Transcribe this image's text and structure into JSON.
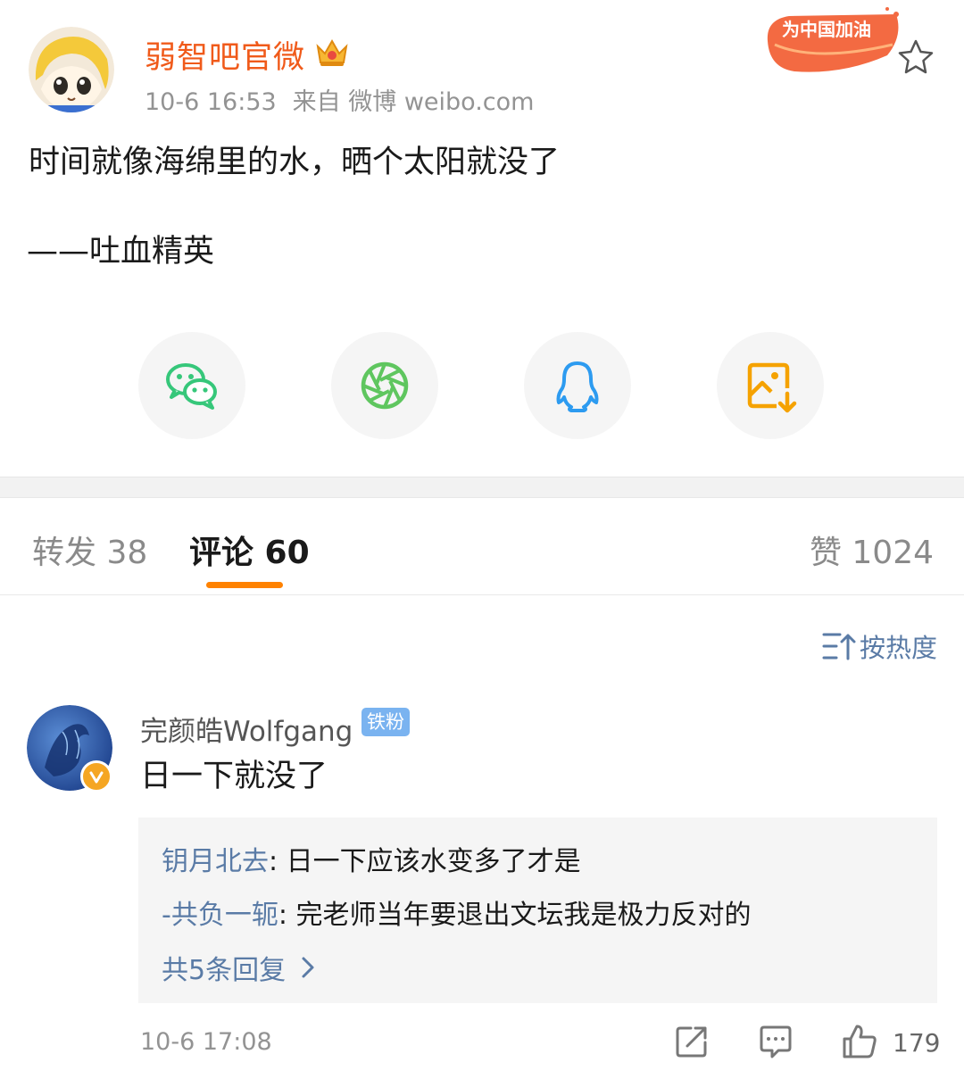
{
  "post": {
    "author": "弱智吧官微",
    "time": "10-6 16:53",
    "source": "来自 微博 weibo.com",
    "banner_text": "为中国加油",
    "text": "时间就像海绵里的水，晒个太阳就没了",
    "signature": "——吐血精英"
  },
  "share": {
    "items": [
      "wechat-icon",
      "moments-icon",
      "qq-icon",
      "save-image-icon"
    ],
    "colors": {
      "wechat": "#36c77a",
      "moments": "#5fc65f",
      "qq": "#2d9bf0",
      "save": "#f5a200"
    }
  },
  "tabs": {
    "repost": "转发 38",
    "comments": "评论 60",
    "likes": "赞 1024"
  },
  "sort": {
    "label": "按热度"
  },
  "comment": {
    "user": "完颜皓Wolfgang",
    "badge": "铁粉",
    "text": "日一下就没了",
    "replies": [
      {
        "user": "钥月北去",
        "sep": ": ",
        "text": "日一下应该水变多了才是"
      },
      {
        "user": "-共负一轭",
        "sep": ": ",
        "text": "完老师当年要退出文坛我是极力反对的"
      }
    ],
    "more_replies": "共5条回复",
    "time": "10-6 17:08",
    "likes": "179"
  },
  "colors": {
    "accent": "#ff8200",
    "author_name": "#f05a1a",
    "link": "#5a7ba6",
    "meta": "#939393"
  }
}
